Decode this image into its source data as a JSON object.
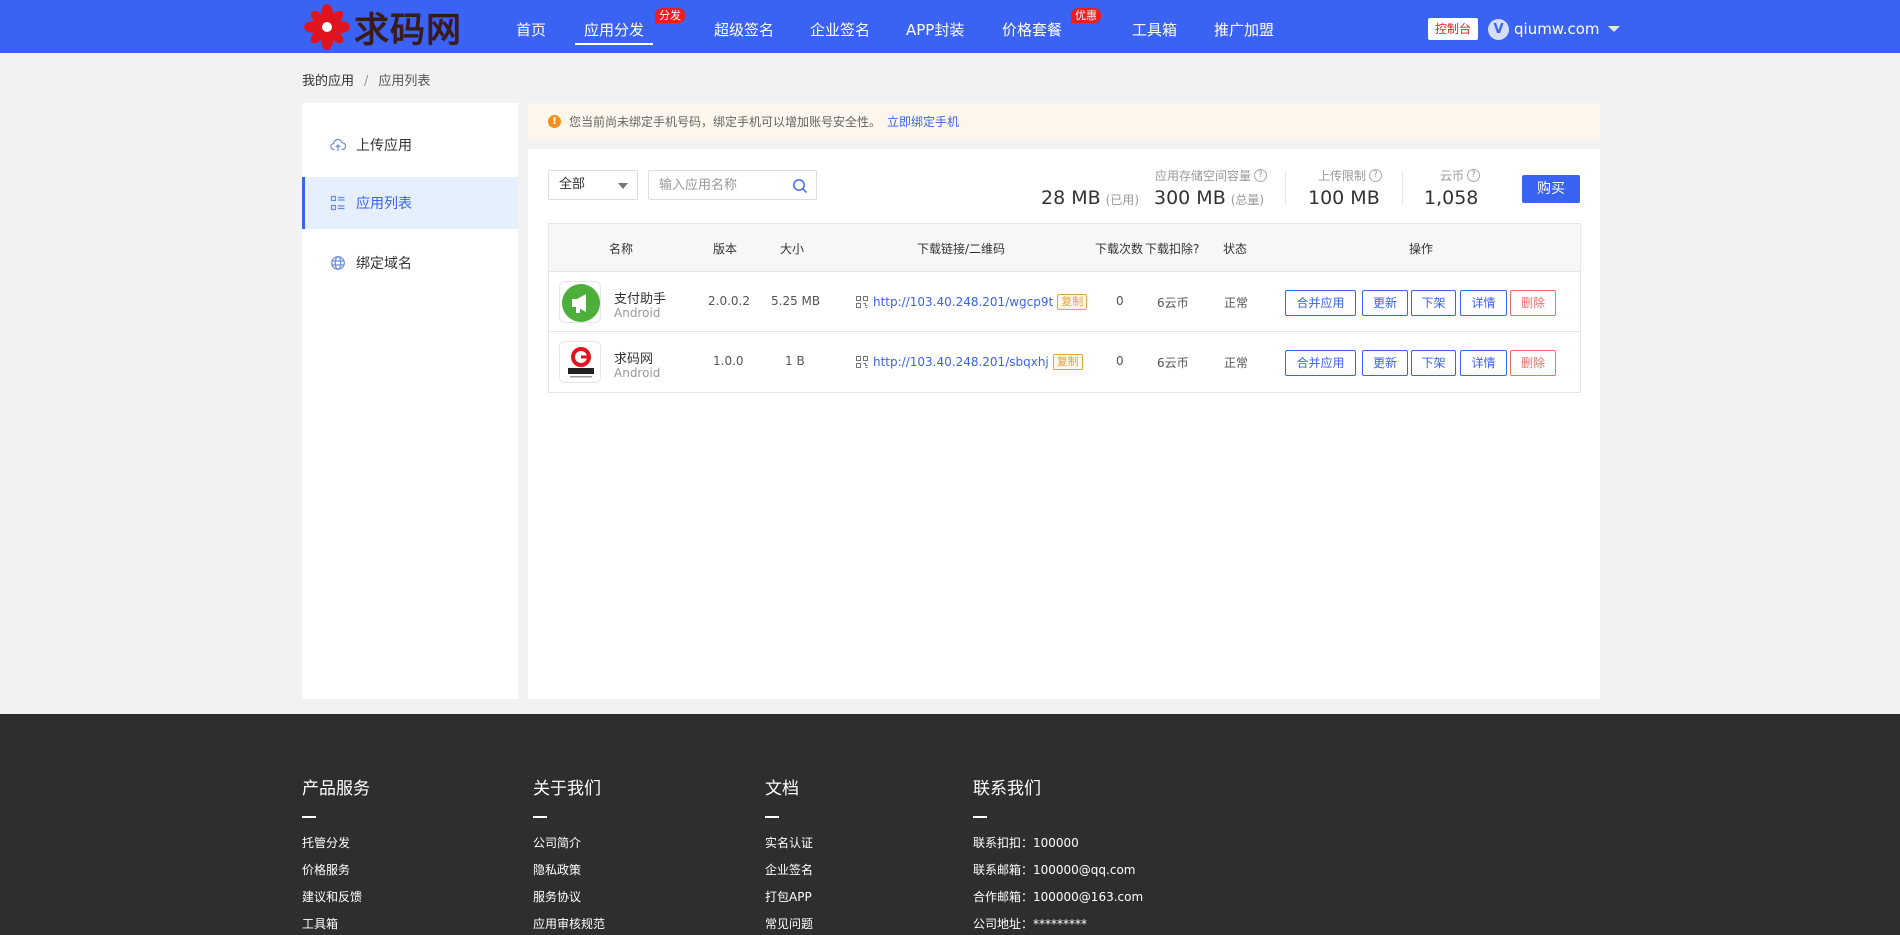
{
  "header": {
    "logo_text": "求码网",
    "nav": [
      {
        "label": "首页",
        "badge": ""
      },
      {
        "label": "应用分发",
        "badge": "分发",
        "active": true
      },
      {
        "label": "超级签名",
        "badge": ""
      },
      {
        "label": "企业签名",
        "badge": ""
      },
      {
        "label": "APP封装",
        "badge": ""
      },
      {
        "label": "价格套餐",
        "badge": "优惠"
      },
      {
        "label": "工具箱",
        "badge": ""
      },
      {
        "label": "推广加盟",
        "badge": ""
      }
    ],
    "console_label": "控制台",
    "user": {
      "avatar": "V",
      "name": "qiumw.com"
    }
  },
  "breadcrumb": {
    "root": "我的应用",
    "sep": "/",
    "current": "应用列表"
  },
  "sidebar": {
    "items": [
      {
        "label": "上传应用",
        "icon": "cloud-upload-icon"
      },
      {
        "label": "应用列表",
        "icon": "list-icon",
        "active": true
      },
      {
        "label": "绑定域名",
        "icon": "globe-icon"
      }
    ]
  },
  "notice": {
    "text": "您当前尚未绑定手机号码，绑定手机可以增加账号安全性。",
    "link": "立即绑定手机"
  },
  "toolbar": {
    "filter_value": "全部",
    "search_placeholder": "输入应用名称"
  },
  "stats": {
    "storage_label": "应用存储空间容量",
    "used_value": "28 MB",
    "used_suffix": "(已用)",
    "total_value": "300 MB",
    "total_suffix": "(总量)",
    "upload_label": "上传限制",
    "upload_value": "100 MB",
    "coin_label": "云币",
    "coin_value": "1,058",
    "buy_label": "购买"
  },
  "table": {
    "headers": {
      "name": "名称",
      "version": "版本",
      "size": "大小",
      "link": "下载链接/二维码",
      "downloads": "下载次数",
      "deduct": "下载扣除?",
      "status": "状态",
      "ops": "操作"
    },
    "rows": [
      {
        "name": "支付助手",
        "platform": "Android",
        "version": "2.0.0.2",
        "size": "5.25 MB",
        "link": "http://103.40.248.201/wgcp9t",
        "copy": "复制",
        "downloads": "0",
        "deduct": "6云币",
        "status": "正常"
      },
      {
        "name": "求码网",
        "platform": "Android",
        "version": "1.0.0",
        "size": "1 B",
        "link": "http://103.40.248.201/sbqxhj",
        "copy": "复制",
        "downloads": "0",
        "deduct": "6云币",
        "status": "正常"
      }
    ],
    "ops": {
      "merge": "合并应用",
      "update": "更新",
      "offline": "下架",
      "detail": "详情",
      "delete": "删除"
    }
  },
  "footer": {
    "cols": [
      {
        "title": "产品服务",
        "items": [
          "托管分发",
          "价格服务",
          "建议和反馈",
          "工具箱"
        ]
      },
      {
        "title": "关于我们",
        "items": [
          "公司简介",
          "隐私政策",
          "服务协议",
          "应用审核规范"
        ]
      },
      {
        "title": "文档",
        "items": [
          "实名认证",
          "企业签名",
          "打包APP",
          "常见问题"
        ]
      },
      {
        "title": "联系我们",
        "items": [
          "联系扣扣：100000",
          "联系邮箱：100000@qq.com",
          "合作邮箱：100000@163.com",
          "公司地址：*********"
        ]
      }
    ]
  },
  "colors": {
    "primary": "#3a62f3",
    "danger": "#f56c6c",
    "badge": "#ef1c1c",
    "footer": "#2e2e30"
  }
}
